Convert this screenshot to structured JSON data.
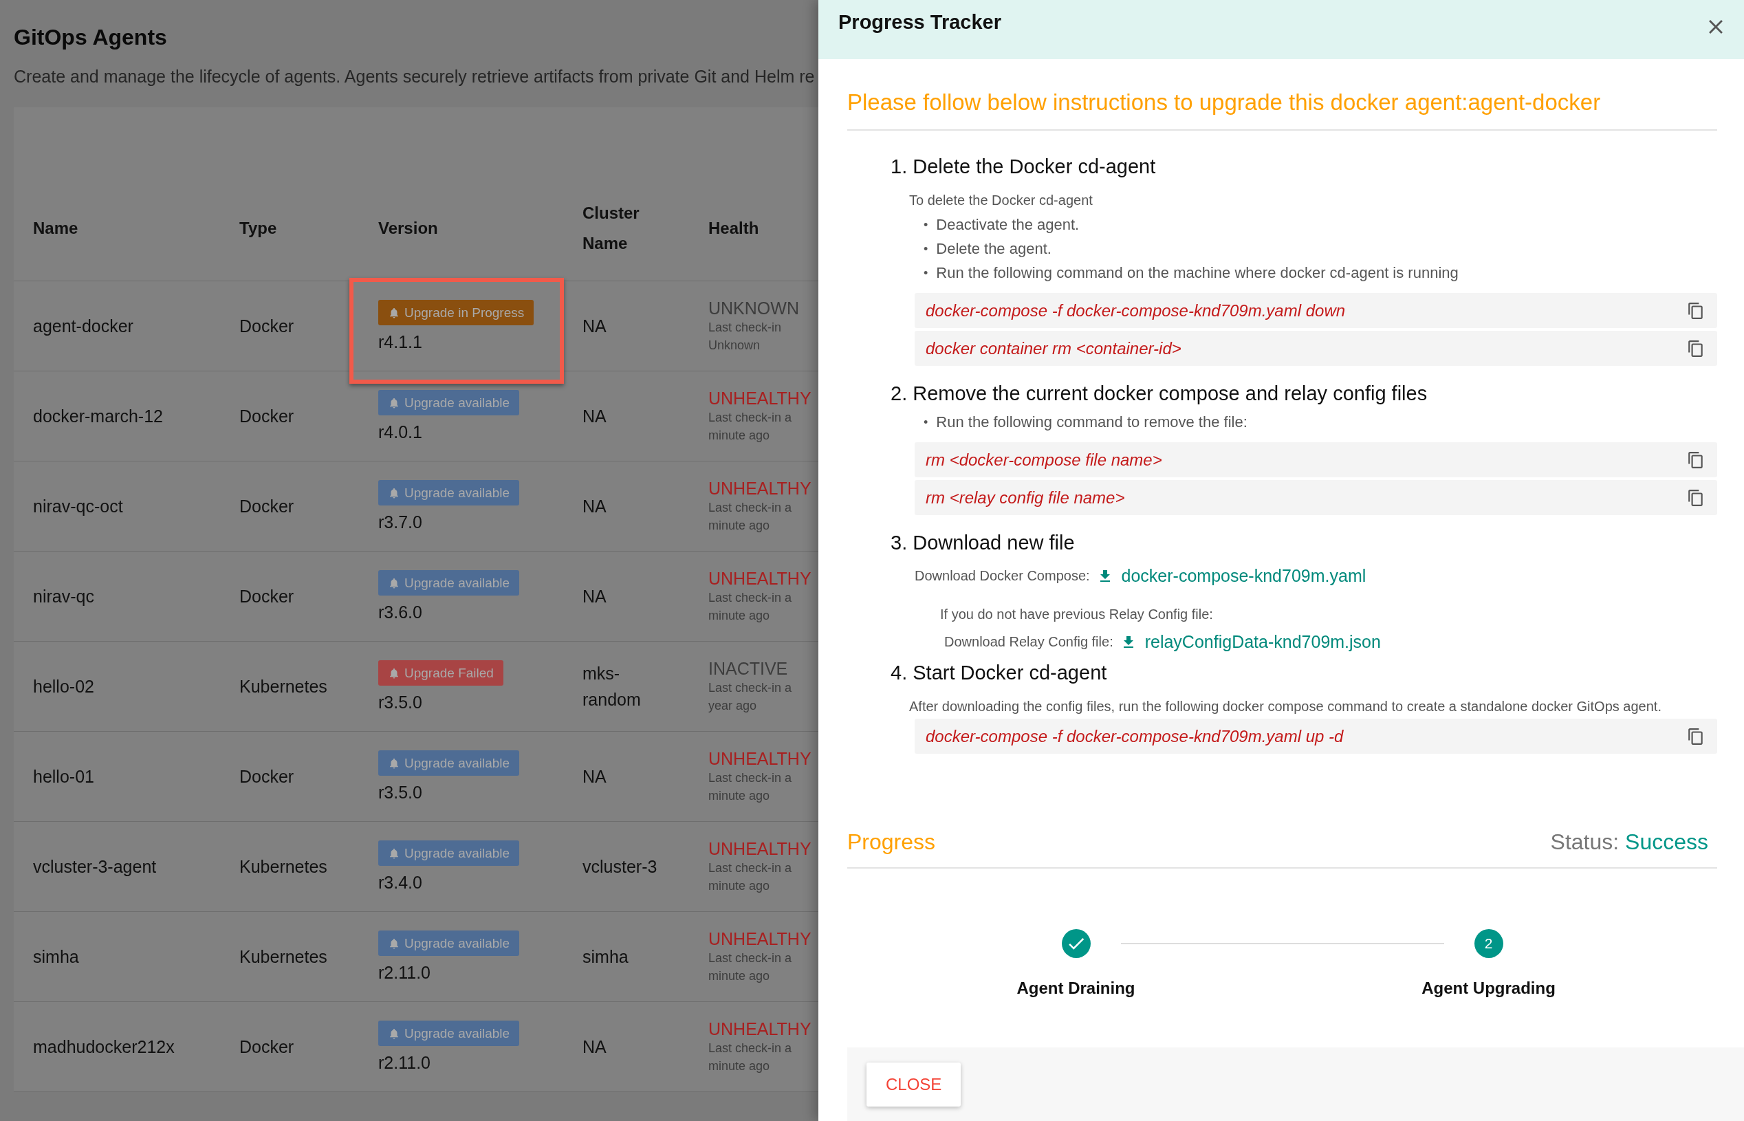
{
  "page": {
    "title": "GitOps Agents",
    "description": "Create and manage the lifecycle of agents. Agents securely retrieve artifacts from private Git and Helm re"
  },
  "table": {
    "columns": [
      "Name",
      "Type",
      "Version",
      "Cluster Name",
      "Health"
    ],
    "rows": [
      {
        "name": "agent-docker",
        "type": "Docker",
        "badge": {
          "label": "Upgrade in Progress",
          "kind": "progress"
        },
        "version": "r4.1.1",
        "cluster": "NA",
        "health": {
          "text": "UNKNOWN",
          "color": "#3d3d3d"
        },
        "checkin": "Last check-in Unknown",
        "highlighted": true
      },
      {
        "name": "docker-march-12",
        "type": "Docker",
        "badge": {
          "label": "Upgrade available",
          "kind": "available"
        },
        "version": "r4.0.1",
        "cluster": "NA",
        "health": {
          "text": "UNHEALTHY",
          "color": "#a82020"
        },
        "checkin": "Last check-in a minute ago",
        "highlighted": false
      },
      {
        "name": "nirav-qc-oct",
        "type": "Docker",
        "badge": {
          "label": "Upgrade available",
          "kind": "available"
        },
        "version": "r3.7.0",
        "cluster": "NA",
        "health": {
          "text": "UNHEALTHY",
          "color": "#a82020"
        },
        "checkin": "Last check-in a minute ago",
        "highlighted": false
      },
      {
        "name": "nirav-qc",
        "type": "Docker",
        "badge": {
          "label": "Upgrade available",
          "kind": "available"
        },
        "version": "r3.6.0",
        "cluster": "NA",
        "health": {
          "text": "UNHEALTHY",
          "color": "#a82020"
        },
        "checkin": "Last check-in a minute ago",
        "highlighted": false
      },
      {
        "name": "hello-02",
        "type": "Kubernetes",
        "badge": {
          "label": "Upgrade Failed",
          "kind": "failed"
        },
        "version": "r3.5.0",
        "cluster": "mks-random",
        "health": {
          "text": "INACTIVE",
          "color": "#3d3d3d"
        },
        "checkin": "Last check-in a year ago",
        "highlighted": false
      },
      {
        "name": "hello-01",
        "type": "Docker",
        "badge": {
          "label": "Upgrade available",
          "kind": "available"
        },
        "version": "r3.5.0",
        "cluster": "NA",
        "health": {
          "text": "UNHEALTHY",
          "color": "#a82020"
        },
        "checkin": "Last check-in a minute ago",
        "highlighted": false
      },
      {
        "name": "vcluster-3-agent",
        "type": "Kubernetes",
        "badge": {
          "label": "Upgrade available",
          "kind": "available"
        },
        "version": "r3.4.0",
        "cluster": "vcluster-3",
        "health": {
          "text": "UNHEALTHY",
          "color": "#a82020"
        },
        "checkin": "Last check-in a minute ago",
        "highlighted": false
      },
      {
        "name": "simha",
        "type": "Kubernetes",
        "badge": {
          "label": "Upgrade available",
          "kind": "available"
        },
        "version": "r2.11.0",
        "cluster": "simha",
        "health": {
          "text": "UNHEALTHY",
          "color": "#a82020"
        },
        "checkin": "Last check-in a minute ago",
        "highlighted": false
      },
      {
        "name": "madhudocker212x",
        "type": "Docker",
        "badge": {
          "label": "Upgrade available",
          "kind": "available"
        },
        "version": "r2.11.0",
        "cluster": "NA",
        "health": {
          "text": "UNHEALTHY",
          "color": "#a82020"
        },
        "checkin": "Last check-in a minute ago",
        "highlighted": false
      }
    ]
  },
  "panel": {
    "title": "Progress Tracker",
    "heading": "Please follow below instructions to upgrade this docker agent:agent-docker",
    "bullet": "•",
    "steps": [
      {
        "title": "1. Delete the Docker cd-agent",
        "intro": "To delete the Docker cd-agent",
        "bullets": [
          "Deactivate the agent.",
          "Delete the agent.",
          "Run the following command on the machine where docker cd-agent is running"
        ],
        "commands": [
          "docker-compose -f docker-compose-knd709m.yaml down",
          "docker container rm <container-id>"
        ]
      },
      {
        "title": "2. Remove the current docker compose and relay config files",
        "bullets": [
          "Run the following command to remove the file:"
        ],
        "commands": [
          "rm <docker-compose file name>",
          "rm <relay config file name>"
        ]
      },
      {
        "title": "3. Download new file",
        "download": {
          "label": "Download Docker Compose:",
          "file": "docker-compose-knd709m.yaml"
        },
        "fallback": {
          "note": "If you do not have previous Relay Config file:",
          "download": {
            "label": "Download Relay Config file:",
            "file": "relayConfigData-knd709m.json"
          }
        }
      },
      {
        "title": "4. Start Docker cd-agent",
        "intro": "After downloading the config files, run the following docker compose command to create a standalone docker GitOps agent.",
        "commands": [
          "docker-compose -f docker-compose-knd709m.yaml up -d"
        ]
      }
    ],
    "progress": {
      "title": "Progress",
      "status_label": "Status:",
      "status": "Success"
    },
    "stepper": [
      {
        "label": "Agent Draining",
        "kind": "done"
      },
      {
        "label": "Agent Upgrading",
        "kind": "current",
        "number": "2"
      }
    ],
    "close_button": "CLOSE"
  }
}
